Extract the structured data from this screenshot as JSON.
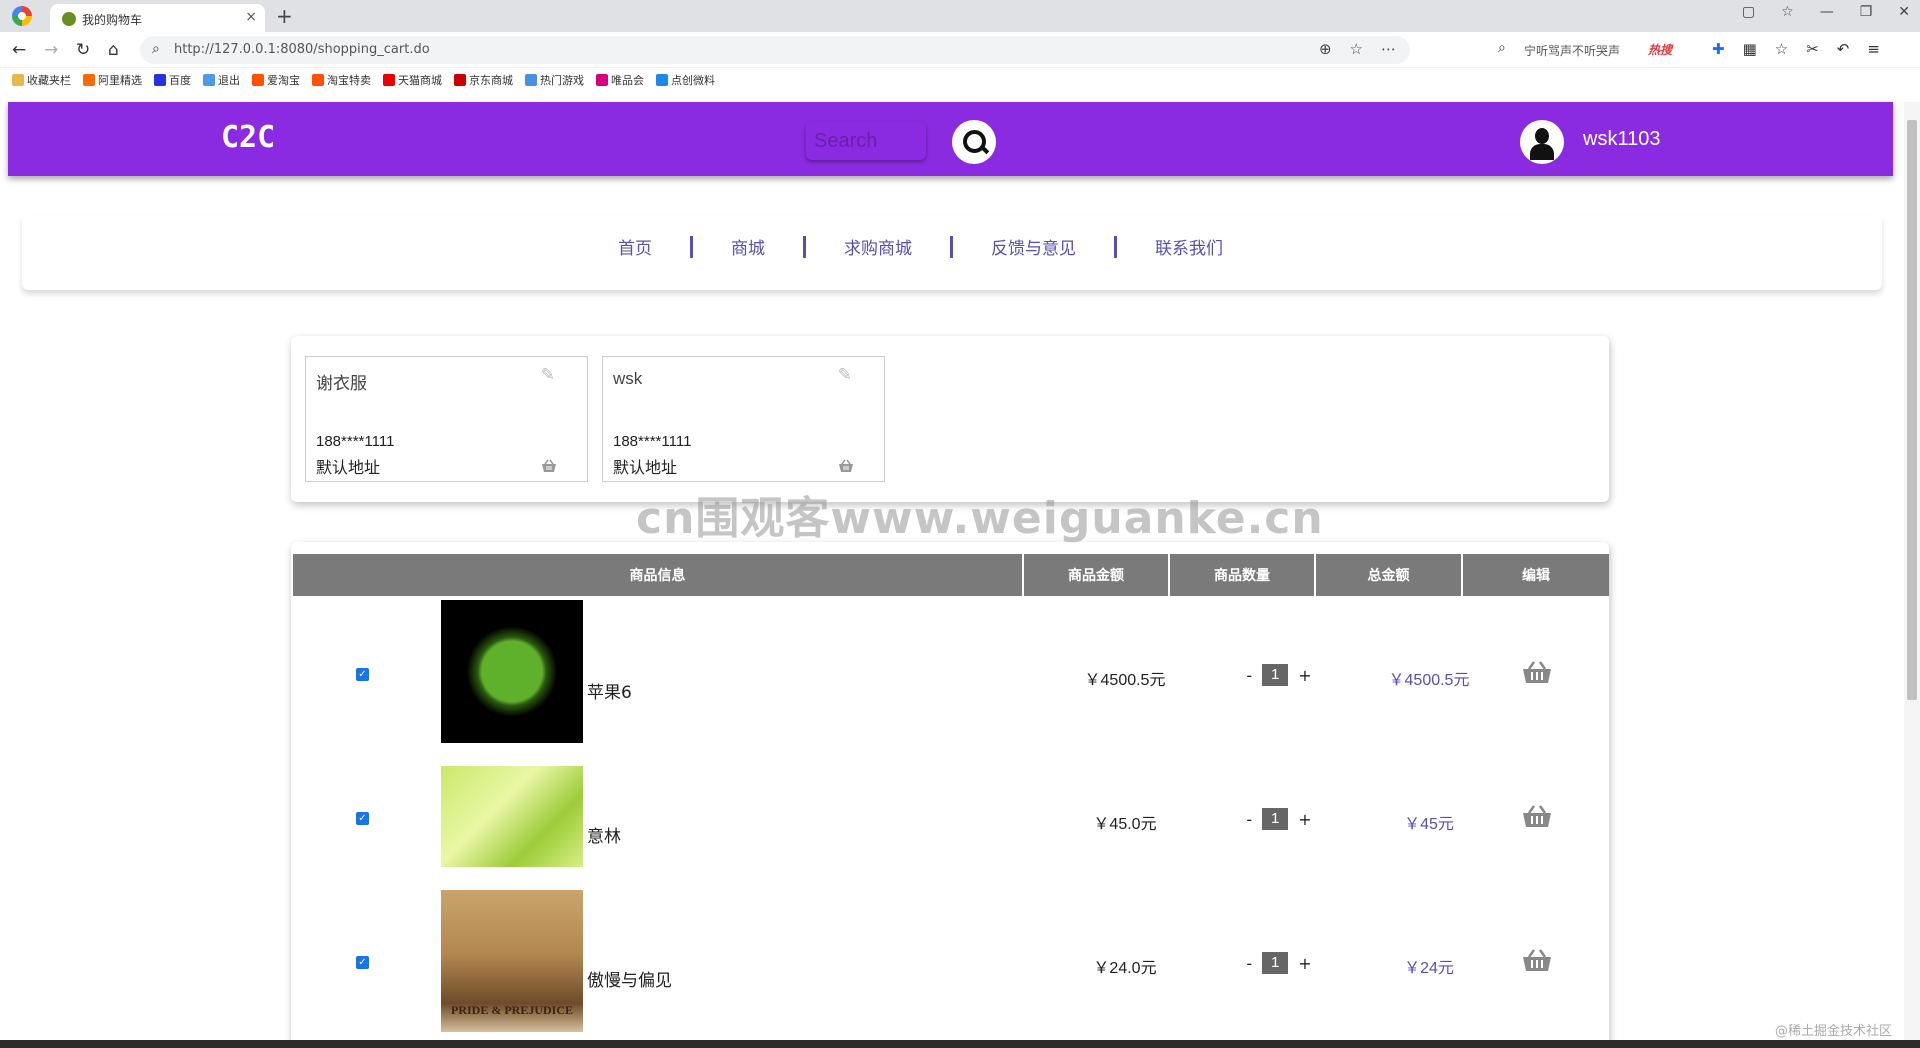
{
  "browser": {
    "tab_title": "我的购物车",
    "tab_close": "×",
    "new_tab": "+",
    "url": "http://127.0.0.1:8080/shopping_cart.do",
    "hot_search_text": "宁听骂声不听哭声",
    "hot_badge": "热搜",
    "bookmarks": [
      "收藏夹栏",
      "阿里精选",
      "百度",
      "退出",
      "爱淘宝",
      "淘宝特卖",
      "天猫商城",
      "京东商城",
      "热门游戏",
      "唯品会",
      "点创微料"
    ],
    "bookmark_colors": [
      "#e8b84a",
      "#ff6a00",
      "#2932e1",
      "#4b9be8",
      "#ff5000",
      "#ff5000",
      "#e00",
      "#c00",
      "#4a90e2",
      "#d6007e",
      "#1e88e5"
    ]
  },
  "header": {
    "logo": "C2C",
    "search_placeholder": "Search",
    "username": "wsk1103",
    "brand_color": "#8a2be2"
  },
  "nav": {
    "items": [
      "首页",
      "商城",
      "求购商城",
      "反馈与意见",
      "联系我们"
    ]
  },
  "addresses": [
    {
      "name": "谢衣服",
      "phone": "188****1111",
      "default_label": "默认地址"
    },
    {
      "name": "wsk",
      "phone": "188****1111",
      "default_label": "默认地址"
    }
  ],
  "watermark": "cn围观客www.weiguanke.cn",
  "cart": {
    "headers": [
      "商品信息",
      "商品金额",
      "商品数量",
      "总金额",
      "编辑"
    ],
    "rows": [
      {
        "name": "苹果6",
        "price": "￥4500.5元",
        "qty": "1",
        "total": "￥4500.5元",
        "checked": true,
        "image": "apple-mascot"
      },
      {
        "name": "意林",
        "price": "￥45.0元",
        "qty": "1",
        "total": "￥45元",
        "checked": true,
        "image": "green-leaves"
      },
      {
        "name": "傲慢与偏见",
        "price": "￥24.0元",
        "qty": "1",
        "total": "￥24元",
        "checked": true,
        "image": "pride-prejudice-poster",
        "image_caption": "PRIDE & PREJUDICE"
      }
    ],
    "minus": "-",
    "plus": "+"
  },
  "corner_mark": "@稀土掘金技术社区"
}
